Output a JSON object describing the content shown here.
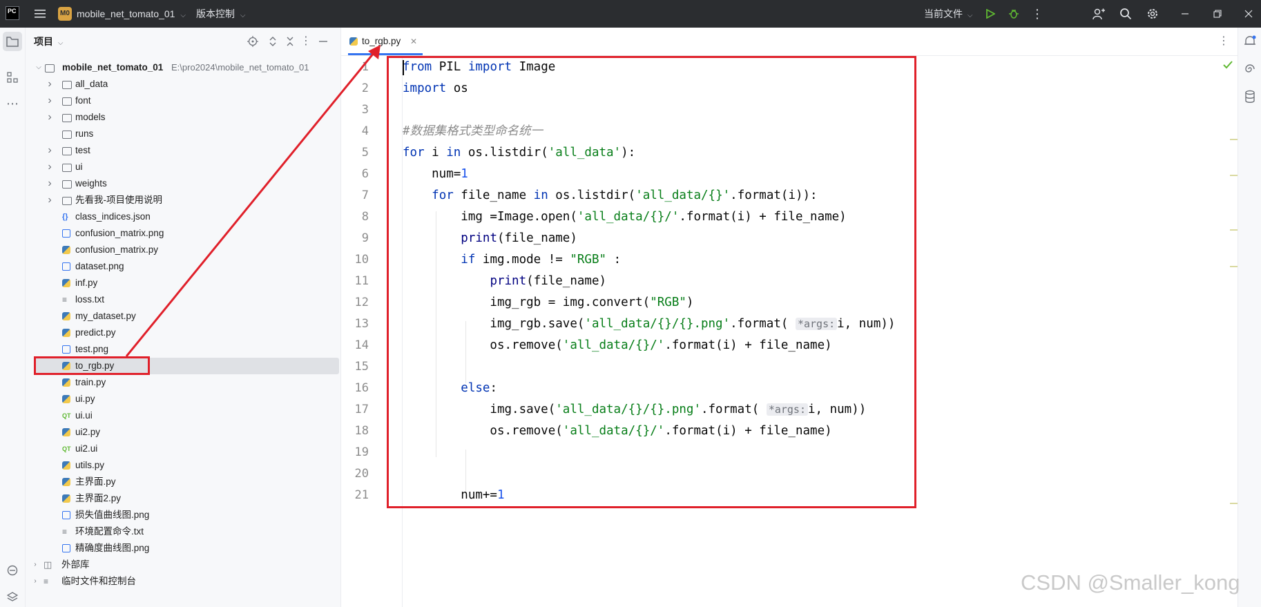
{
  "titlebar": {
    "app_logo_text": "PC",
    "project_badge": "M0",
    "project_name": "mobile_net_tomato_01",
    "vcs_label": "版本控制",
    "run_config_label": "当前文件"
  },
  "project_panel": {
    "title": "项目",
    "root_name": "mobile_net_tomato_01",
    "root_path": "E:\\pro2024\\mobile_net_tomato_01",
    "items": [
      {
        "name": "all_data",
        "type": "folder",
        "expandable": true
      },
      {
        "name": "font",
        "type": "folder",
        "expandable": true
      },
      {
        "name": "models",
        "type": "folder",
        "expandable": true
      },
      {
        "name": "runs",
        "type": "folder",
        "expandable": false
      },
      {
        "name": "test",
        "type": "folder",
        "expandable": true
      },
      {
        "name": "ui",
        "type": "folder",
        "expandable": true
      },
      {
        "name": "weights",
        "type": "folder",
        "expandable": true
      },
      {
        "name": "先看我-项目使用说明",
        "type": "folder",
        "expandable": true
      },
      {
        "name": "class_indices.json",
        "type": "json"
      },
      {
        "name": "confusion_matrix.png",
        "type": "png"
      },
      {
        "name": "confusion_matrix.py",
        "type": "py"
      },
      {
        "name": "dataset.png",
        "type": "png"
      },
      {
        "name": "inf.py",
        "type": "py"
      },
      {
        "name": "loss.txt",
        "type": "txt"
      },
      {
        "name": "my_dataset.py",
        "type": "py"
      },
      {
        "name": "predict.py",
        "type": "py"
      },
      {
        "name": "test.png",
        "type": "png"
      },
      {
        "name": "to_rgb.py",
        "type": "py",
        "selected": true
      },
      {
        "name": "train.py",
        "type": "py"
      },
      {
        "name": "ui.py",
        "type": "py"
      },
      {
        "name": "ui.ui",
        "type": "ui"
      },
      {
        "name": "ui2.py",
        "type": "py"
      },
      {
        "name": "ui2.ui",
        "type": "ui"
      },
      {
        "name": "utils.py",
        "type": "py"
      },
      {
        "name": "主界面.py",
        "type": "py"
      },
      {
        "name": "主界面2.py",
        "type": "py"
      },
      {
        "name": "损失值曲线图.png",
        "type": "png"
      },
      {
        "name": "环境配置命令.txt",
        "type": "txt"
      },
      {
        "name": "精确度曲线图.png",
        "type": "png"
      }
    ],
    "external_libs": "外部库",
    "scratches": "临时文件和控制台"
  },
  "editor": {
    "tab_label": "to_rgb.py",
    "line_numbers": [
      "1",
      "2",
      "3",
      "4",
      "5",
      "6",
      "7",
      "8",
      "9",
      "10",
      "11",
      "12",
      "13",
      "14",
      "15",
      "16",
      "17",
      "18",
      "19",
      "20",
      "21"
    ],
    "hint_label": "*args:"
  },
  "watermark": "CSDN @Smaller_kong"
}
